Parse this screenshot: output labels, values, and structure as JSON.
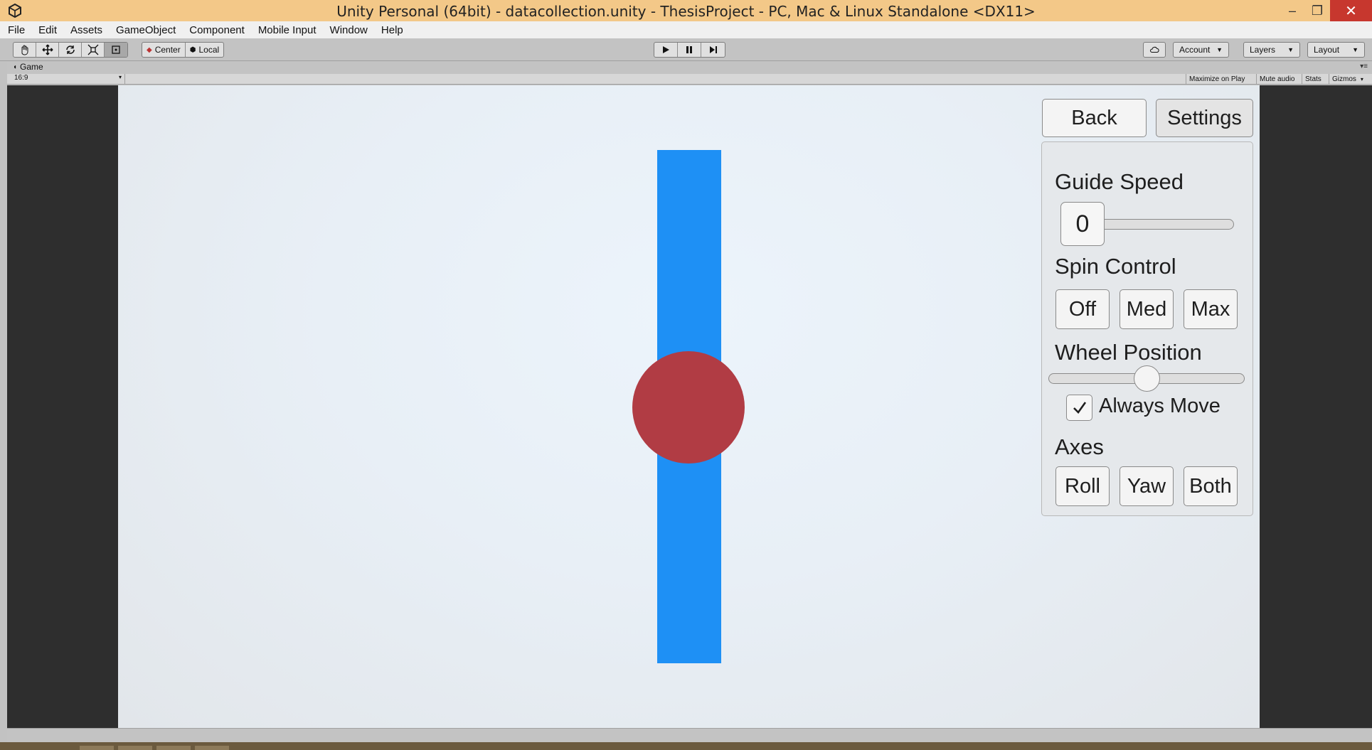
{
  "window": {
    "title": "Unity Personal (64bit) - datacollection.unity - ThesisProject - PC, Mac & Linux Standalone <DX11>",
    "minimize_glyph": "‒",
    "maximize_glyph": "❐",
    "close_glyph": "✕"
  },
  "menu": [
    "File",
    "Edit",
    "Assets",
    "GameObject",
    "Component",
    "Mobile Input",
    "Window",
    "Help"
  ],
  "toolbar": {
    "tools": [
      "hand-icon",
      "move-icon",
      "rotate-icon",
      "scale-icon",
      "rect-tool-icon"
    ],
    "pivot_label": "Center",
    "space_label": "Local",
    "play_controls": [
      "play-icon",
      "pause-icon",
      "step-icon"
    ],
    "account_label": "Account",
    "layers_label": "Layers",
    "layout_label": "Layout"
  },
  "game_view": {
    "tab_label": "Game",
    "aspect": "16:9",
    "maximize_on_play": "Maximize on Play",
    "mute_audio": "Mute audio",
    "stats": "Stats",
    "gizmos": "Gizmos"
  },
  "scene": {
    "bar_color": "#1e90f5",
    "ball_color": "#b13c44"
  },
  "game_ui": {
    "back_label": "Back",
    "settings_label": "Settings",
    "guide_speed_label": "Guide Speed",
    "guide_speed_value": "0",
    "spin_control_label": "Spin Control",
    "spin_options": [
      "Off",
      "Med",
      "Max"
    ],
    "wheel_position_label": "Wheel Position",
    "wheel_position_value": 0.5,
    "always_move_label": "Always Move",
    "always_move_checked": true,
    "axes_label": "Axes",
    "axes_options": [
      "Roll",
      "Yaw",
      "Both"
    ]
  }
}
